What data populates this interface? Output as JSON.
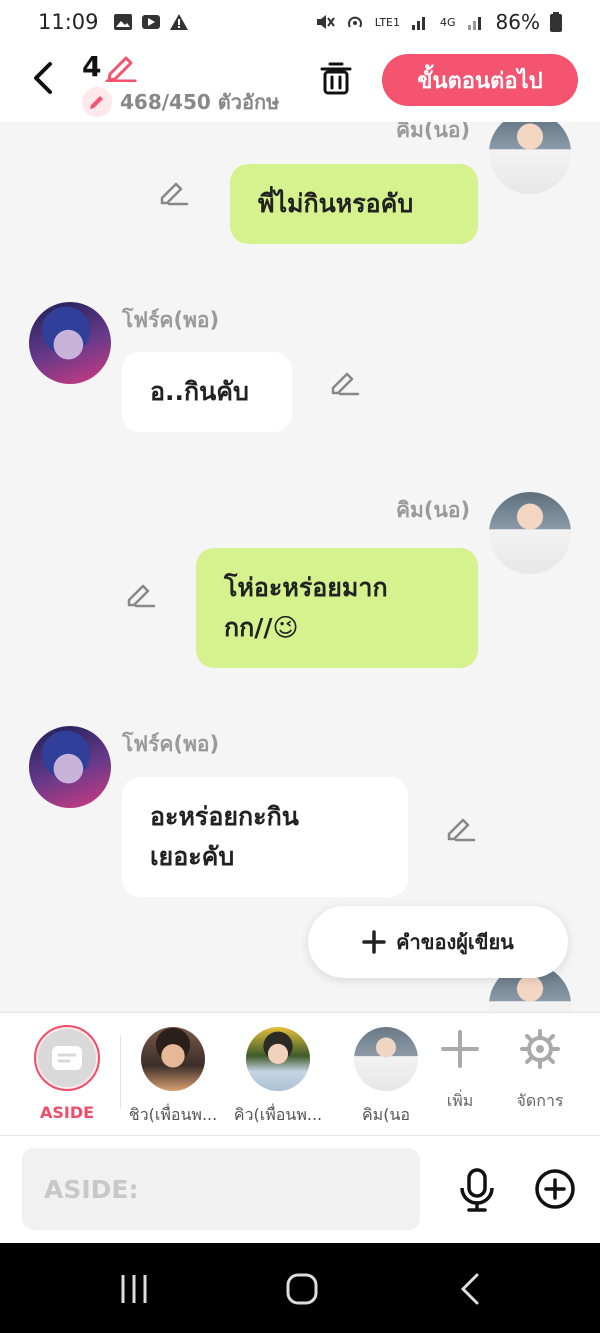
{
  "status": {
    "time": "11:09",
    "battery": "86%",
    "network_label": "LTE1",
    "net_4g": "4G"
  },
  "header": {
    "chapter_number": "4",
    "char_counter": "468/450 ตัวอักษ",
    "next_label": "ขั้นตอนต่อไป"
  },
  "chat": {
    "messages": [
      {
        "sender": "คิม(นอ)",
        "text": "พี่ไม่กินหรอคับ",
        "side": "right"
      },
      {
        "sender": "โฟร์ค(พอ)",
        "text": "อ..กินคับ",
        "side": "left"
      },
      {
        "sender": "คิม(นอ)",
        "line1": "โห่อะหร่อยมาก",
        "line2": "กก//",
        "emoji": "😉",
        "side": "right"
      },
      {
        "sender": "โฟร์ค(พอ)",
        "line1": "อะหร่อยกะกิน",
        "line2": "เยอะคับ",
        "side": "left"
      }
    ],
    "author_button_label": "คำของผู้เขียน"
  },
  "characters": {
    "aside_label": "ASIDE",
    "items": [
      {
        "label": "ชิว(เพื่อนพ..."
      },
      {
        "label": "คิว(เพื่อนพ..."
      },
      {
        "label": "คิม(นอ"
      }
    ],
    "add_label": "เพิ่ม",
    "manage_label": "จัดการ"
  },
  "input": {
    "placeholder": "ASIDE:"
  },
  "colors": {
    "accent": "#f4546f",
    "bubble_green": "#d6f28e"
  }
}
